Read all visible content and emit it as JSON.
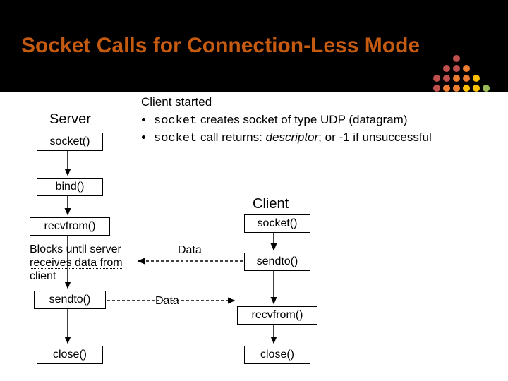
{
  "title": "Socket Calls for Connection-Less Mode",
  "server_label": "Server",
  "client_label": "Client",
  "explain": {
    "heading": "Client started",
    "b1_code": "socket",
    "b1_rest": " creates socket of type UDP (datagram)",
    "b2_code": "socket",
    "b2_rest1": " call returns:  ",
    "b2_ital": "descriptor",
    "b2_rest2": ";  or -1 if unsuccessful"
  },
  "boxes": {
    "srv_socket": "socket()",
    "srv_bind": "bind()",
    "srv_recvfrom": "recvfrom()",
    "srv_sendto": "sendto()",
    "srv_close": "close()",
    "cli_socket": "socket()",
    "cli_sendto": "sendto()",
    "cli_recvfrom": "recvfrom()",
    "cli_close": "close()"
  },
  "note": {
    "l1": "Blocks until server",
    "l2": "receives data from",
    "l3": "client"
  },
  "data1": "Data",
  "data2": "Data",
  "dot_colors": {
    "red": "#c0504d",
    "orange": "#ed7d31",
    "yellow": "#ffc000",
    "green": "#9bbb59"
  }
}
